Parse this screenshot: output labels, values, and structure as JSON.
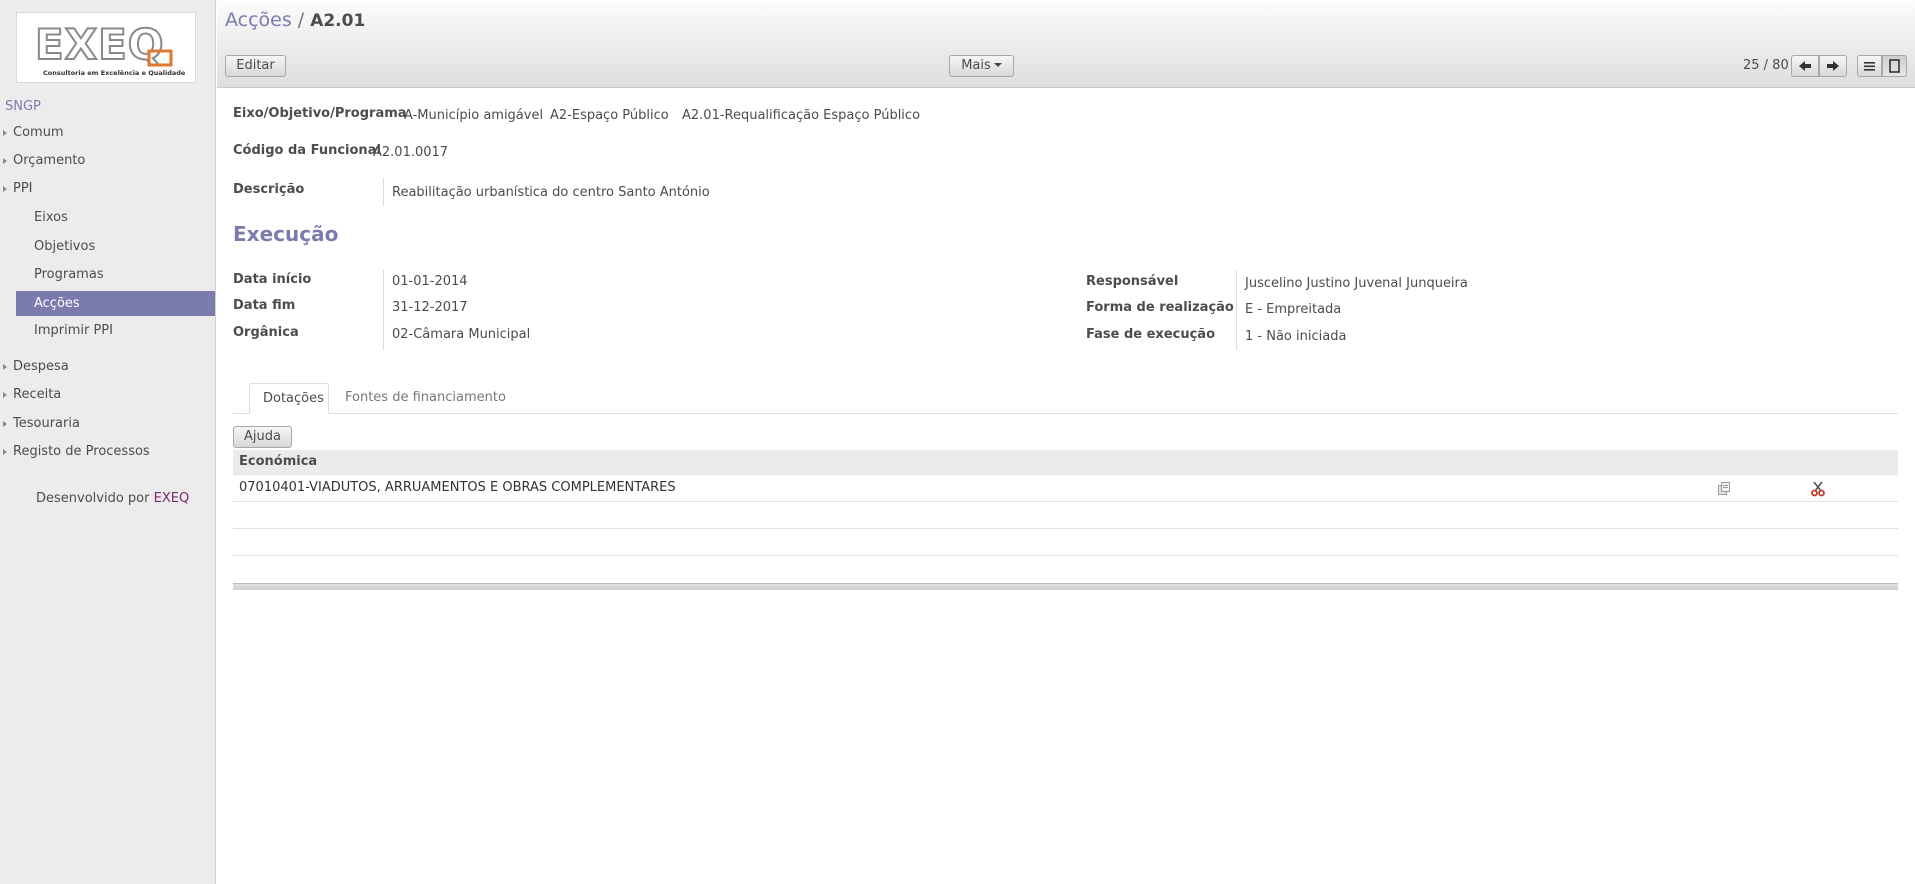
{
  "sidebar": {
    "logo_text": "EXEQ",
    "logo_tagline": "Consultoria em Excelência e Qualidade",
    "app_name": "SNGP",
    "menu": [
      {
        "label": "Comum"
      },
      {
        "label": "Orçamento"
      },
      {
        "label": "PPI"
      }
    ],
    "sub_menu": [
      {
        "label": "Eixos"
      },
      {
        "label": "Objetivos"
      },
      {
        "label": "Programas"
      },
      {
        "label": "Acções"
      },
      {
        "label": "Imprimir PPI"
      }
    ],
    "menu_after": [
      {
        "label": "Despesa"
      },
      {
        "label": "Receita"
      },
      {
        "label": "Tesouraria"
      },
      {
        "label": "Registo de Processos"
      }
    ],
    "developed_by": "Desenvolvido por",
    "developer": "EXEQ"
  },
  "header": {
    "breadcrumb_parent": "Acções",
    "breadcrumb_sep": "/",
    "breadcrumb_current": "A2.01",
    "edit_label": "Editar",
    "more_label": "Mais",
    "pager": "25 / 80"
  },
  "form": {
    "eixo_label": "Eixo/Objetivo/Programa",
    "eixo_value": "A-Município amigável",
    "objetivo_value": "A2-Espaço Público",
    "programa_value": "A2.01-Requalificação Espaço Público",
    "codigo_label": "Código da Funcional",
    "codigo_value": "A2.01.0017",
    "descricao_label": "Descrição",
    "descricao_value": "Reabilitação urbanística do centro Santo António",
    "section_title": "Execução",
    "data_inicio_label": "Data início",
    "data_inicio_value": "01-01-2014",
    "data_fim_label": "Data fim",
    "data_fim_value": "31-12-2017",
    "organica_label": "Orgânica",
    "organica_value": "02-Câmara Municipal",
    "responsavel_label": "Responsável",
    "responsavel_value": "Juscelino Justino Juvenal Junqueira",
    "forma_label": "Forma de realização",
    "forma_value": "E - Empreitada",
    "fase_label": "Fase de execução",
    "fase_value": "1 - Não iniciada"
  },
  "tabs": [
    {
      "label": "Dotações",
      "active": true
    },
    {
      "label": "Fontes de financiamento",
      "active": false
    }
  ],
  "dotacoes": {
    "help_label": "Ajuda",
    "column_header": "Económica",
    "rows": [
      {
        "economica": "07010401-VIADUTOS, ARRUAMENTOS E OBRAS COMPLEMENTARES"
      }
    ]
  },
  "colors": {
    "accent": "#7c7bad",
    "brand": "#7b2a6b",
    "logo_orange": "#e07a2e"
  }
}
